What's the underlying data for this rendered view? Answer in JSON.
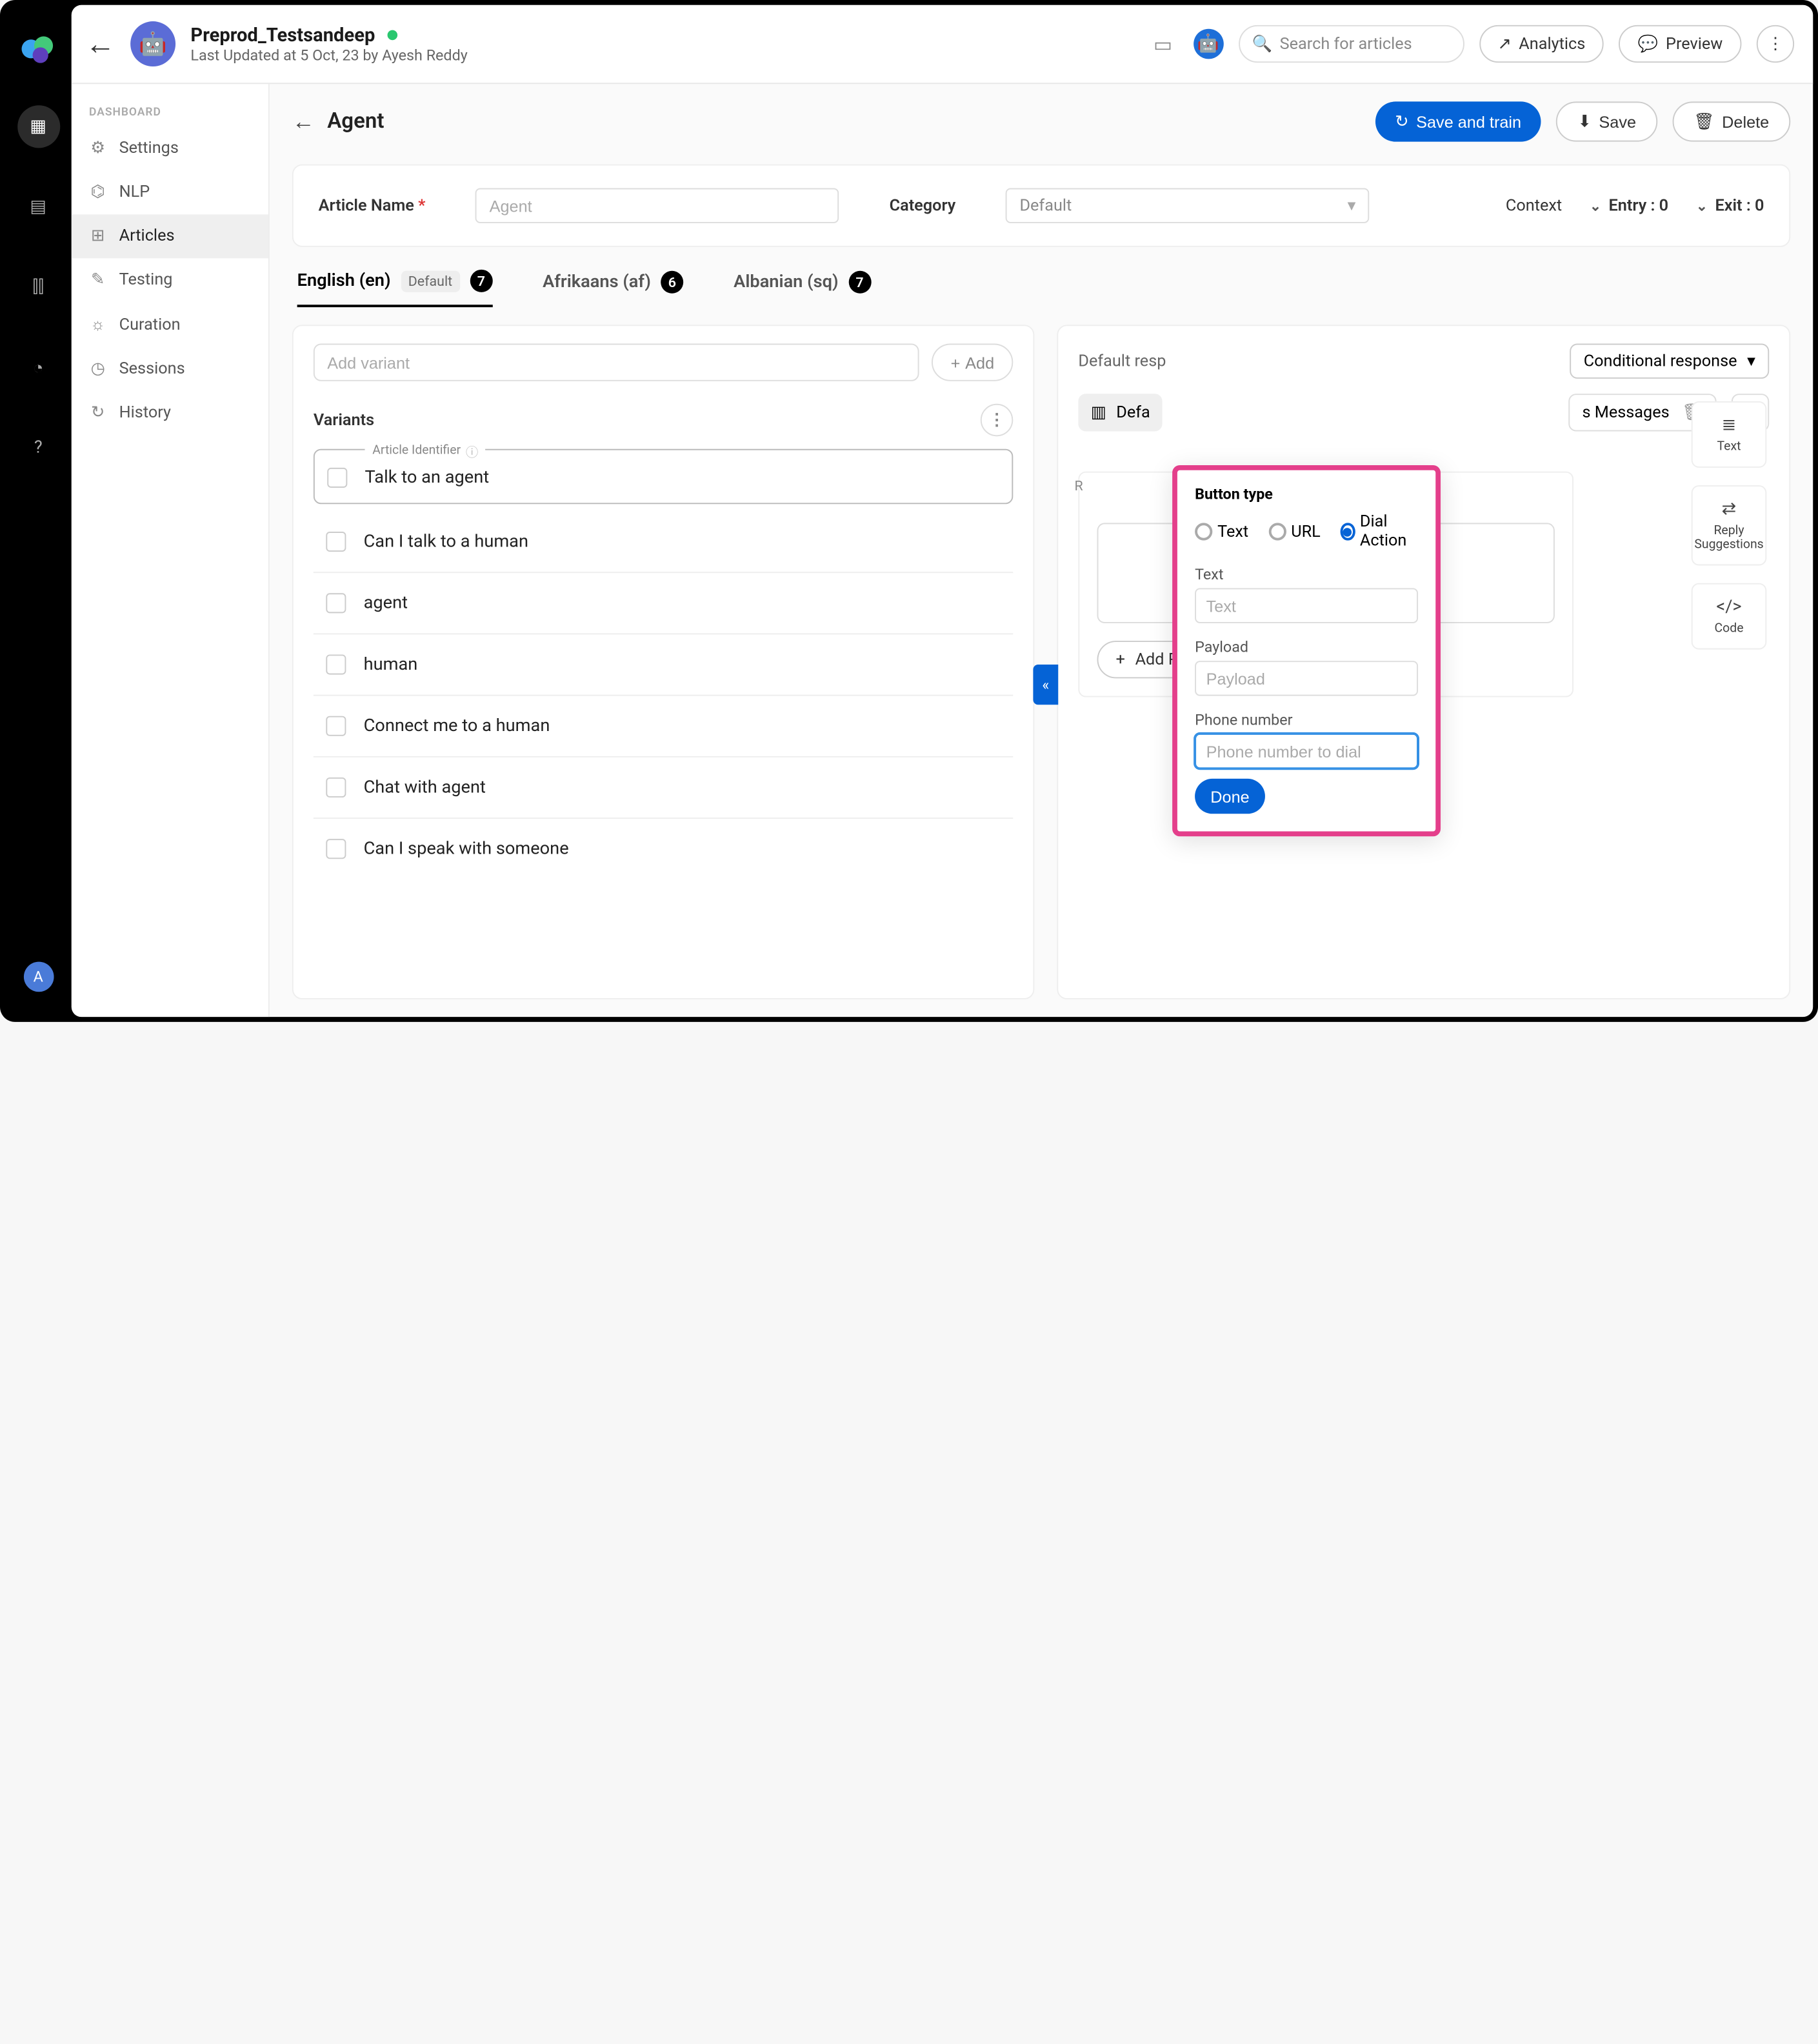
{
  "header": {
    "bot_name": "Preprod_Testsandeep",
    "last_updated": "Last Updated at 5 Oct, 23 by Ayesh Reddy",
    "search_placeholder": "Search for articles",
    "analytics_label": "Analytics",
    "preview_label": "Preview"
  },
  "sidebar": {
    "header": "DASHBOARD",
    "items": [
      {
        "icon": "⚙",
        "label": "Settings"
      },
      {
        "icon": "⌬",
        "label": "NLP"
      },
      {
        "icon": "⊞",
        "label": "Articles"
      },
      {
        "icon": "✎",
        "label": "Testing"
      },
      {
        "icon": "☼",
        "label": "Curation"
      },
      {
        "icon": "◷",
        "label": "Sessions"
      },
      {
        "icon": "↻",
        "label": "History"
      }
    ]
  },
  "page": {
    "title": "Agent",
    "save_train": "Save and train",
    "save": "Save",
    "delete": "Delete"
  },
  "article_bar": {
    "name_label": "Article Name",
    "name_placeholder": "Agent",
    "category_label": "Category",
    "category_value": "Default",
    "context_label": "Context",
    "entry": "Entry : 0",
    "exit": "Exit : 0"
  },
  "lang_tabs": [
    {
      "label": "English (en)",
      "default_badge": "Default",
      "count": "7"
    },
    {
      "label": "Afrikaans (af)",
      "count": "6"
    },
    {
      "label": "Albanian (sq)",
      "count": "7"
    }
  ],
  "left_panel": {
    "addvar_placeholder": "Add variant",
    "add_btn": "Add",
    "variants_hdr": "Variants",
    "art_id_label": "Article Identifier",
    "art_id_value": "Talk to an agent",
    "variants": [
      "Can I talk to a human",
      "agent",
      "human",
      "Connect me to a human",
      "Chat with agent",
      "Can I speak with someone"
    ]
  },
  "right_panel": {
    "default_resp": "Default resp",
    "cond_resp": "Conditional response",
    "default_channel": "Defa",
    "channel_pill": "s Messages",
    "reply_card_left": "R",
    "add_reply": "Add Reply Suggestion"
  },
  "mini_tools": {
    "text": "Text",
    "reply": "Reply Suggestions",
    "code": "Code"
  },
  "popover": {
    "title": "Button type",
    "opt_text": "Text",
    "opt_url": "URL",
    "opt_dial": "Dial Action",
    "text_label": "Text",
    "text_placeholder": "Text",
    "payload_label": "Payload",
    "payload_placeholder": "Payload",
    "phone_label": "Phone number",
    "phone_placeholder": "Phone number to dial",
    "done": "Done"
  },
  "rail_avatar": "A"
}
